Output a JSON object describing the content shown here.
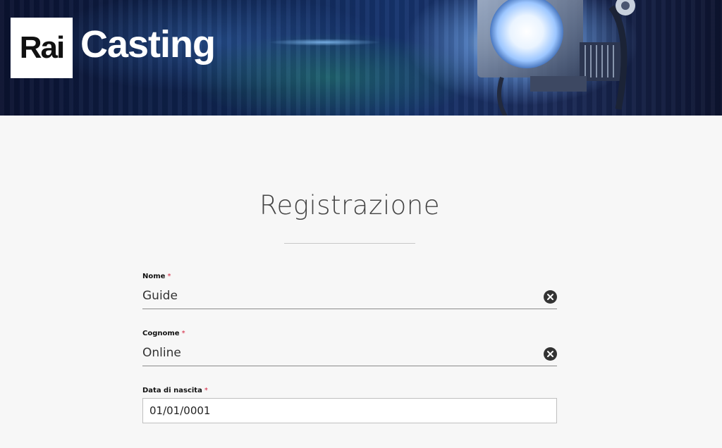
{
  "header": {
    "logo_rai": "Rai",
    "logo_casting": "Casting"
  },
  "form": {
    "title": "Registrazione",
    "required_marker": "*",
    "fields": {
      "nome": {
        "label": "Nome",
        "value": "Guide"
      },
      "cognome": {
        "label": "Cognome",
        "value": "Online"
      },
      "data_nascita": {
        "label": "Data di nascita",
        "value": "01/01/0001"
      }
    }
  },
  "icons": {
    "clear": "close-circle-icon",
    "spotlight": "spotlight-icon"
  },
  "colors": {
    "required": "#d4213d",
    "text": "#333333",
    "banner": "#16346e"
  }
}
